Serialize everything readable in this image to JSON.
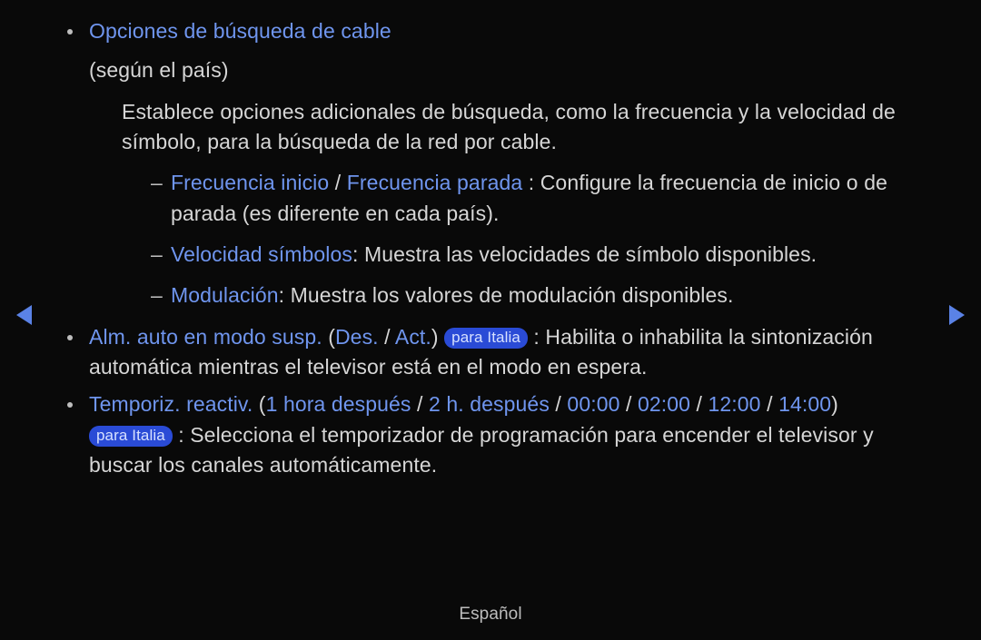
{
  "items": [
    {
      "title": "Opciones de búsqueda de cable",
      "note": "(según el país)",
      "desc": "Establece opciones adicionales de búsqueda, como la frecuencia y la velocidad de símbolo, para la búsqueda de la red por cable.",
      "sub": [
        {
          "term1": "Frecuencia inicio",
          "sep": " / ",
          "term2": "Frecuencia parada",
          "after": " : Configure la frecuencia de inicio o de parada (es diferente en cada país)."
        },
        {
          "term1": "Velocidad símbolos",
          "after": ": Muestra las velocidades de símbolo disponibles."
        },
        {
          "term1": "Modulación",
          "after": ": Muestra los valores de modulación disponibles."
        }
      ]
    },
    {
      "title": "Alm. auto en modo susp.",
      "paren_open": " (",
      "opt1": "Des.",
      "optsep": " / ",
      "opt2": "Act.",
      "paren_close": ") ",
      "badge": "para Italia",
      "after": " : Habilita o inhabilita la sintonización automática mientras el televisor está en el modo en espera."
    },
    {
      "title": "Temporiz. reactiv.",
      "paren_open": " (",
      "opts": [
        "1 hora después",
        "2 h. después",
        "00:00",
        "02:00",
        "12:00",
        "14:00"
      ],
      "optsep": " / ",
      "paren_close": ") ",
      "badge": "para Italia",
      "after": " : Selecciona el temporizador de programación para encender el televisor y buscar los canales automáticamente."
    }
  ],
  "footer": "Español"
}
